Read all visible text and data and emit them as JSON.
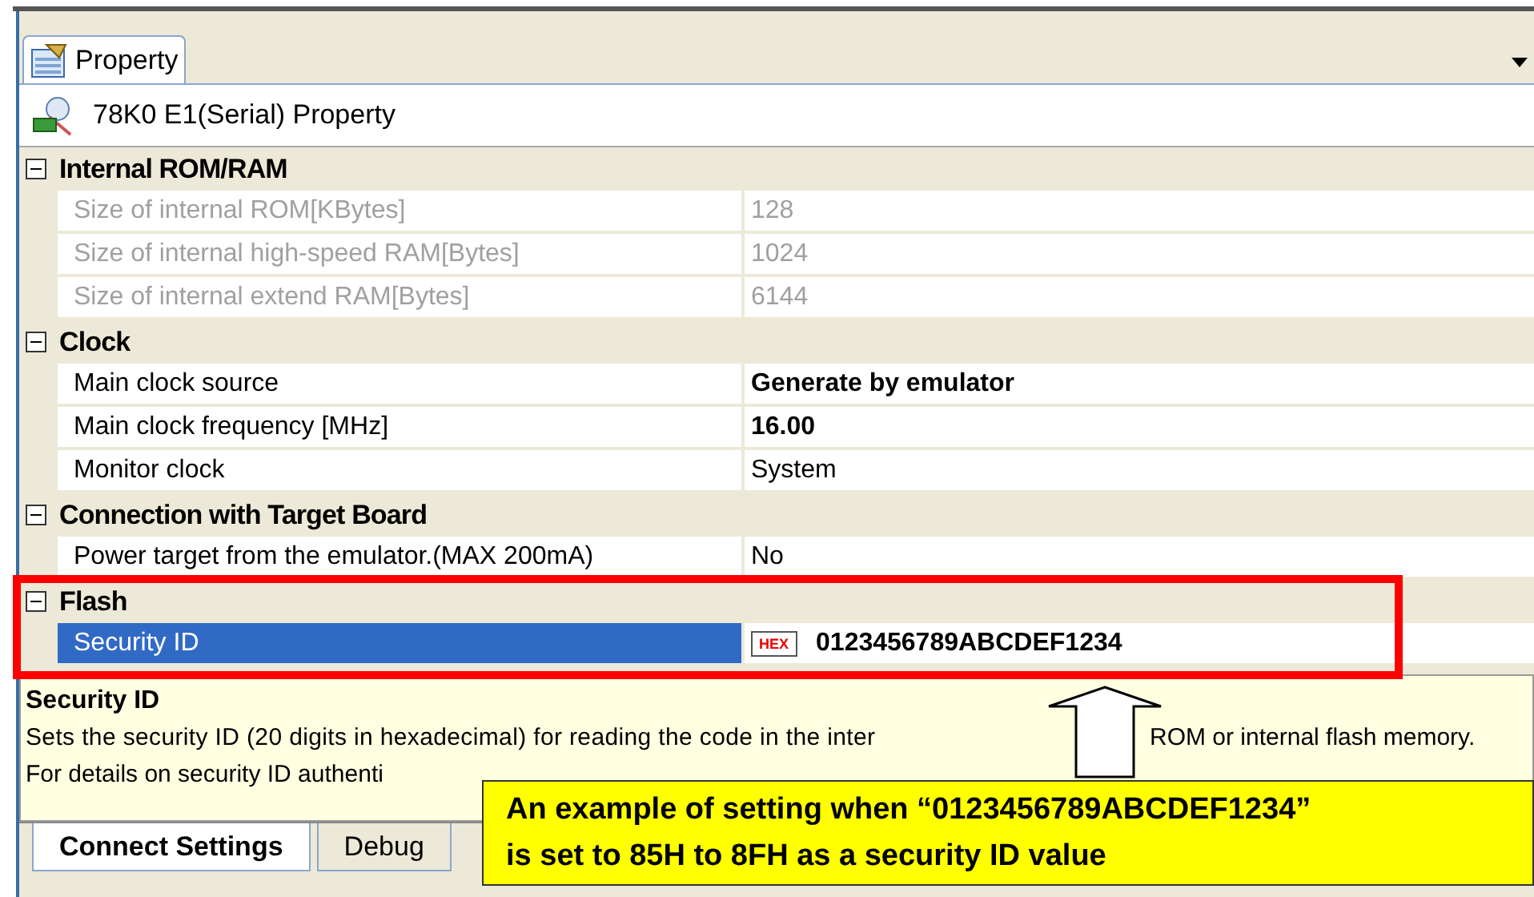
{
  "panel_tab": {
    "label": "Property",
    "selected": true
  },
  "title": "78K0 E1(Serial) Property",
  "categories": [
    {
      "label": "Internal ROM/RAM",
      "expanded": true,
      "rows": [
        {
          "label": "Size of internal ROM[KBytes]",
          "value": "128",
          "disabled": true,
          "bold": false,
          "selected": false
        },
        {
          "label": "Size of internal high-speed RAM[Bytes]",
          "value": "1024",
          "disabled": true,
          "bold": false,
          "selected": false
        },
        {
          "label": "Size of internal extend RAM[Bytes]",
          "value": "6144",
          "disabled": true,
          "bold": false,
          "selected": false
        }
      ]
    },
    {
      "label": "Clock",
      "expanded": true,
      "rows": [
        {
          "label": "Main clock source",
          "value": "Generate by emulator",
          "disabled": false,
          "bold": true,
          "selected": false
        },
        {
          "label": "Main clock frequency [MHz]",
          "value": "16.00",
          "disabled": false,
          "bold": true,
          "selected": false
        },
        {
          "label": "Monitor clock",
          "value": "System",
          "disabled": false,
          "bold": false,
          "selected": false
        }
      ]
    },
    {
      "label": "Connection with Target Board",
      "expanded": true,
      "rows": [
        {
          "label": "Power target from the emulator.(MAX 200mA)",
          "value": "No",
          "disabled": false,
          "bold": false,
          "selected": false
        }
      ]
    },
    {
      "label": "Flash",
      "expanded": true,
      "rows": [
        {
          "label": "Security ID",
          "value": "0123456789ABCDEF1234",
          "badge": "HEX",
          "disabled": false,
          "bold": true,
          "selected": true
        }
      ]
    }
  ],
  "description": {
    "title": "Security ID",
    "line1_start": "Sets the security ID (20 digits in hexadecimal) for reading the code in the inter",
    "line1_end": "ROM or internal flash memory.",
    "line2": "For details on security ID authenti"
  },
  "bottom_tabs": [
    {
      "label": "Connect Settings",
      "selected": true
    },
    {
      "label": "Debug",
      "selected": false
    }
  ],
  "callout": {
    "lines": [
      "An example of setting when “0123456789ABCDEF1234”",
      "is set to 85H to 8FH as a security ID value"
    ]
  }
}
